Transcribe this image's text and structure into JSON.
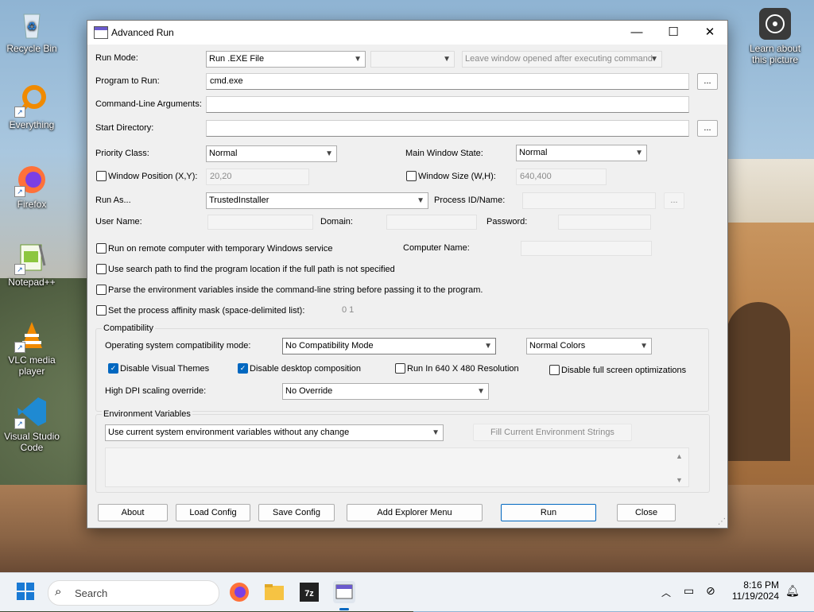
{
  "desktop": {
    "icons": [
      {
        "label": "Recycle Bin"
      },
      {
        "label": "Everything"
      },
      {
        "label": "Firefox"
      },
      {
        "label": "Notepad++"
      },
      {
        "label": "VLC media player"
      },
      {
        "label": "Visual Studio Code"
      }
    ],
    "learn_about": "Learn about this picture"
  },
  "window": {
    "title": "Advanced Run",
    "run_mode_label": "Run Mode:",
    "run_mode_value": "Run .EXE File",
    "leave_window_value": "Leave window opened after executing command",
    "program_label": "Program to Run:",
    "program_value": "cmd.exe",
    "cmdline_label": "Command-Line Arguments:",
    "startdir_label": "Start Directory:",
    "browse_label": "...",
    "priority_label": "Priority Class:",
    "priority_value": "Normal",
    "mainwin_label": "Main Window State:",
    "mainwin_value": "Normal",
    "winpos_label": "Window Position (X,Y):",
    "winpos_value": "20,20",
    "winsize_label": "Window Size (W,H):",
    "winsize_value": "640,400",
    "runas_label": "Run As...",
    "runas_value": "TrustedInstaller",
    "procid_label": "Process ID/Name:",
    "username_label": "User Name:",
    "domain_label": "Domain:",
    "password_label": "Password:",
    "remote_label": "Run on remote computer with temporary Windows service",
    "computer_label": "Computer Name:",
    "searchpath_label": "Use search path to find the program location if the full path is not specified",
    "parseenv_label": "Parse the environment variables inside the command-line string before passing it to the program.",
    "affinity_label": "Set the process affinity mask (space-delimited list):",
    "affinity_value": "0 1",
    "compat_group": "Compatibility",
    "oscompat_label": "Operating system compatibility mode:",
    "oscompat_value": "No Compatibility Mode",
    "colors_value": "Normal Colors",
    "disable_themes": "Disable Visual Themes",
    "disable_composition": "Disable desktop composition",
    "run640": "Run In 640 X 480 Resolution",
    "disable_fullscreen": "Disable full screen optimizations",
    "dpi_label": "High DPI scaling override:",
    "dpi_value": "No Override",
    "env_group": "Environment Variables",
    "env_value": "Use current system environment variables without any change",
    "fill_env": "Fill Current Environment Strings",
    "buttons": {
      "about": "About",
      "load": "Load Config",
      "save": "Save Config",
      "explorer": "Add Explorer Menu",
      "run": "Run",
      "close": "Close"
    }
  },
  "taskbar": {
    "search_placeholder": "Search",
    "time": "8:16 PM",
    "date": "11/19/2024"
  },
  "colors": {
    "accent": "#0067c0"
  }
}
